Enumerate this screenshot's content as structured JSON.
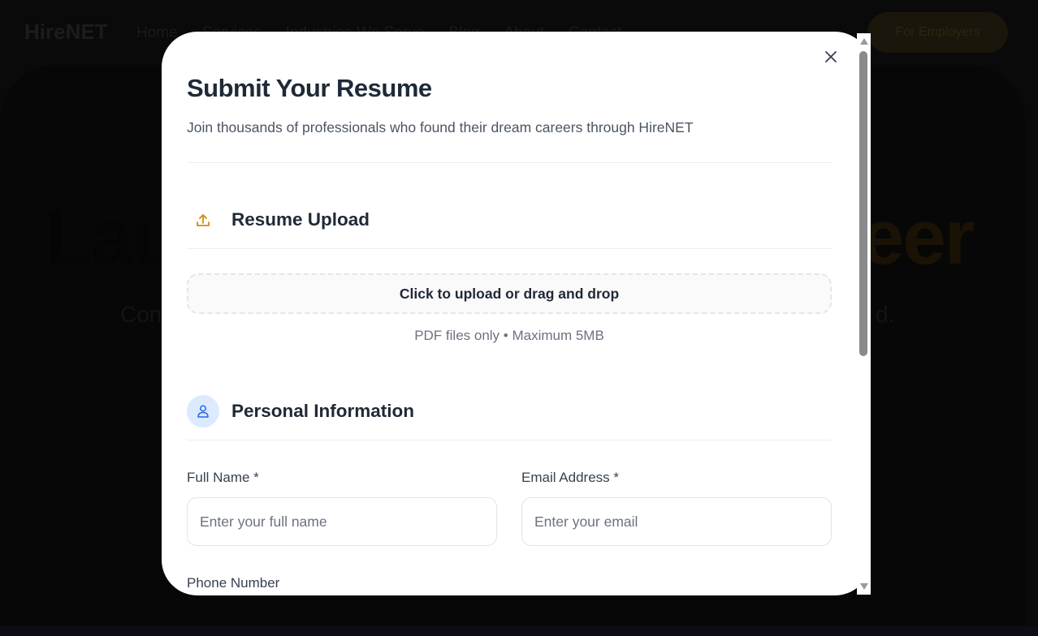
{
  "background": {
    "logo": "HireNET",
    "nav_links": [
      "Home",
      "Services",
      "Industries We Serve",
      "Blog",
      "About",
      "Contact"
    ],
    "employers_button": "For Employers",
    "headline_start": "Lau",
    "headline_end": "eer",
    "subtext_start": "Con",
    "subtext_end": "d."
  },
  "modal": {
    "title": "Submit Your Resume",
    "subtitle": "Join thousands of professionals who found their dream careers through HireNET",
    "close_icon": "close-icon",
    "upload_section": {
      "icon": "upload-icon",
      "title": "Resume Upload",
      "dropzone_text": "Click to upload or drag and drop",
      "hint": "PDF files only • Maximum 5MB"
    },
    "personal_section": {
      "icon": "user-icon",
      "title": "Personal Information",
      "full_name_label": "Full Name *",
      "full_name_placeholder": "Enter your full name",
      "email_label": "Email Address *",
      "email_placeholder": "Enter your email",
      "phone_label": "Phone Number"
    }
  },
  "colors": {
    "accent": "#d08a0e",
    "user_icon": "#2563eb",
    "user_icon_bg": "#dbeafe"
  }
}
